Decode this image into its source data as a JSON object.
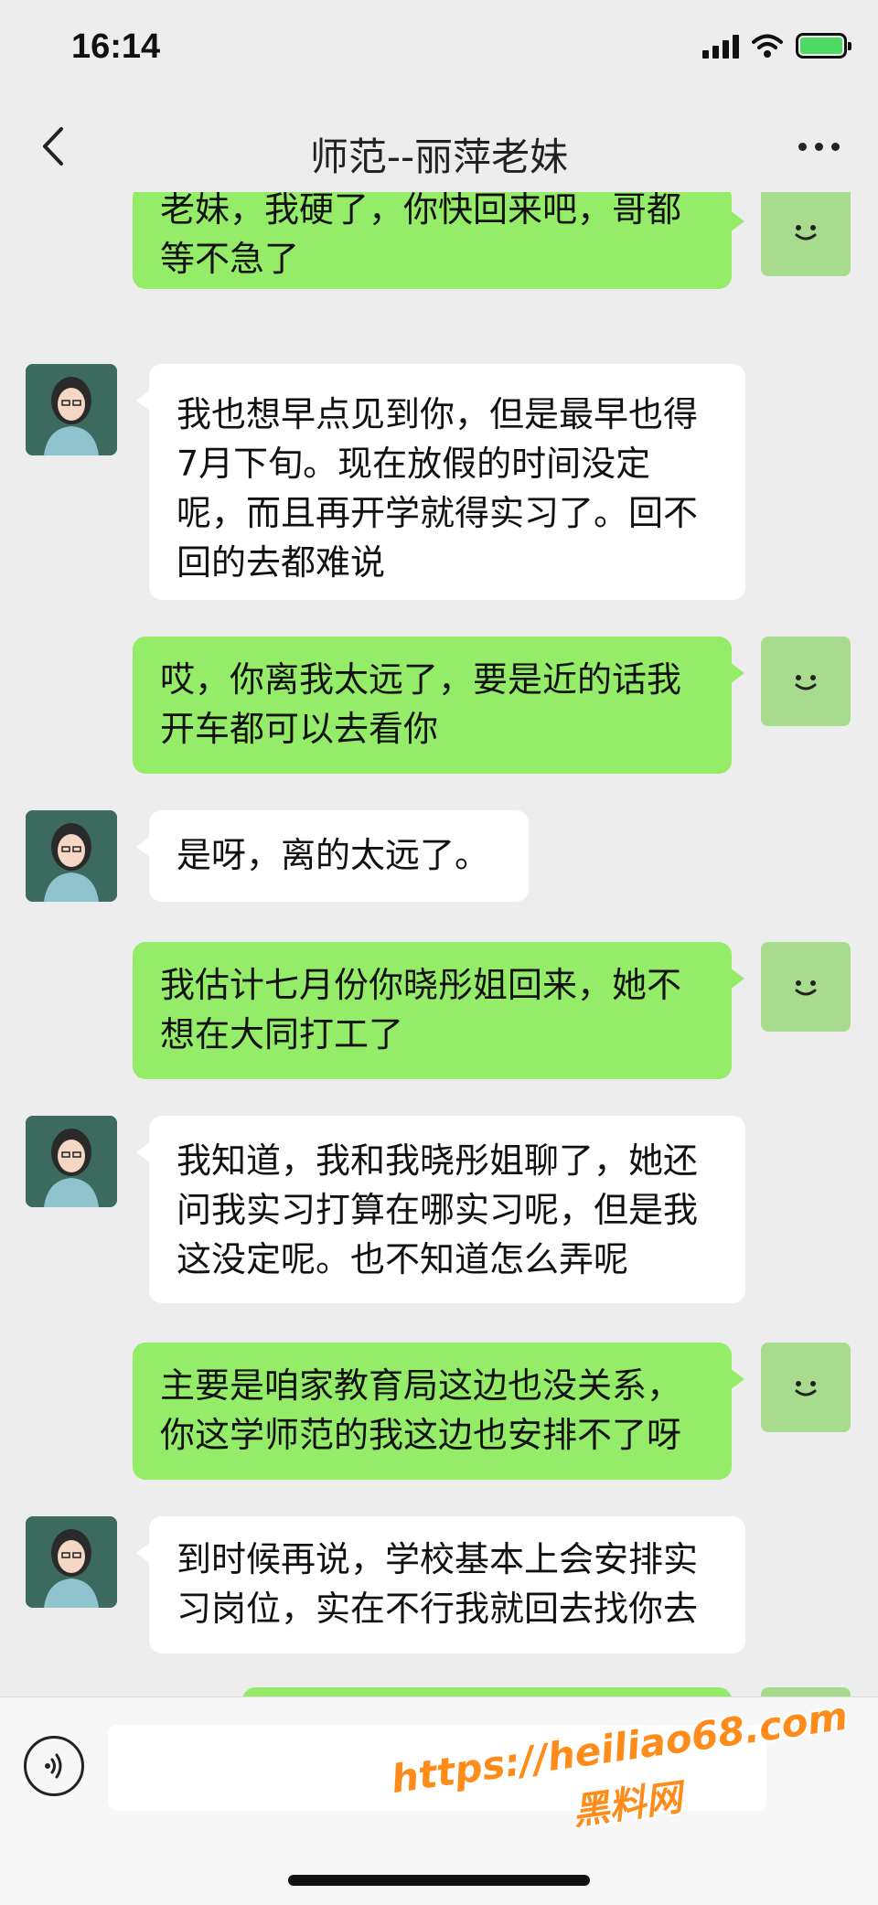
{
  "status_bar": {
    "time": "16:14"
  },
  "header": {
    "title": "师范--丽萍老妹"
  },
  "messages": [
    {
      "direction": "out",
      "text": "老妹，我硬了，你快回来吧，哥都等不急了"
    },
    {
      "direction": "in",
      "text": "我也想早点见到你，但是最早也得7月下旬。现在放假的时间没定呢，而且再开学就得实习了。回不回的去都难说"
    },
    {
      "direction": "out",
      "text": "哎，你离我太远了，要是近的话我开车都可以去看你"
    },
    {
      "direction": "in",
      "text": "是呀，离的太远了。"
    },
    {
      "direction": "out",
      "text": "我估计七月份你晓彤姐回来，她不想在大同打工了"
    },
    {
      "direction": "in",
      "text": "我知道，我和我晓彤姐聊了，她还问我实习打算在哪实习呢，但是我这没定呢。也不知道怎么弄呢"
    },
    {
      "direction": "out",
      "text": "主要是咱家教育局这边也没关系，你这学师范的我这边也安排不了呀"
    },
    {
      "direction": "in",
      "text": "到时候再说，学校基本上会安排实习岗位，实在不行我就回去找你去"
    }
  ],
  "input": {
    "value": "",
    "placeholder": ""
  },
  "watermark": {
    "url": "https://heiliao68.com",
    "name": "黑料网"
  },
  "colors": {
    "outgoing_bubble": "#95ec69",
    "incoming_bubble": "#ffffff",
    "background": "#ededed",
    "watermark": "#ff8c1a"
  },
  "icons": {
    "back": "chevron-left-icon",
    "more": "more-dots-icon",
    "voice": "voice-icon",
    "signal": "signal-icon",
    "wifi": "wifi-icon",
    "battery": "battery-charging-icon"
  }
}
